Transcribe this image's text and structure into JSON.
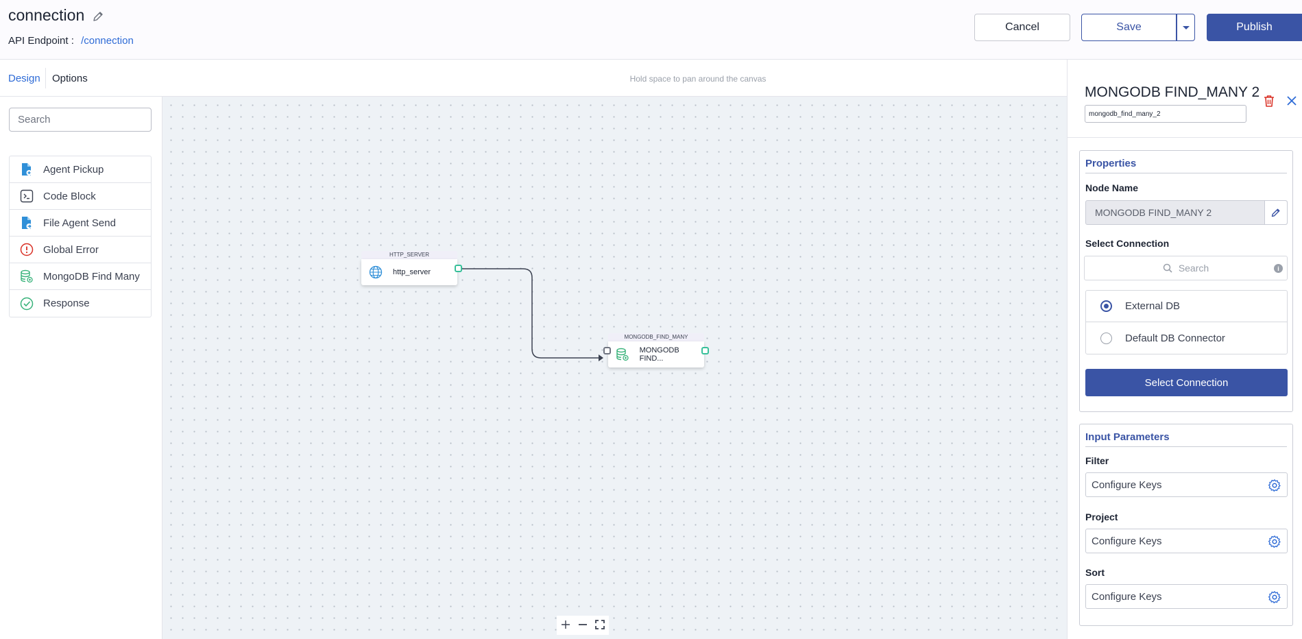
{
  "header": {
    "title": "connection",
    "endpoint_label": "API Endpoint :",
    "endpoint_path": "/connection",
    "cancel_label": "Cancel",
    "save_label": "Save",
    "publish_label": "Publish"
  },
  "tabs": {
    "design": "Design",
    "options": "Options",
    "hint": "Hold space to pan around the canvas"
  },
  "palette": {
    "search_placeholder": "Search",
    "items": [
      {
        "label": "Agent Pickup",
        "icon": "agent-pickup-icon"
      },
      {
        "label": "Code Block",
        "icon": "code-block-icon"
      },
      {
        "label": "File Agent Send",
        "icon": "file-agent-send-icon"
      },
      {
        "label": "Global Error",
        "icon": "global-error-icon"
      },
      {
        "label": "MongoDB Find Many",
        "icon": "mongodb-icon"
      },
      {
        "label": "Response",
        "icon": "response-icon"
      }
    ]
  },
  "canvas": {
    "nodes": [
      {
        "type": "HTTP_SERVER",
        "label": "http_server",
        "icon": "globe-icon"
      },
      {
        "type": "MONGODB_FIND_MANY",
        "label": "MONGODB FIND...",
        "icon": "mongodb-icon"
      }
    ]
  },
  "panel": {
    "title": "MONGODB FIND_MANY 2",
    "node_id": "mongodb_find_many_2",
    "properties": {
      "heading": "Properties",
      "node_name_label": "Node Name",
      "node_name_value": "MONGODB FIND_MANY 2",
      "select_connection_label": "Select Connection",
      "search_placeholder": "Search",
      "radio_external": "External DB",
      "radio_default": "Default DB Connector",
      "selected_radio": "External DB",
      "select_button": "Select Connection"
    },
    "inputs": {
      "heading": "Input Parameters",
      "filter_label": "Filter",
      "filter_value": "Configure Keys",
      "project_label": "Project",
      "project_value": "Configure Keys",
      "sort_label": "Sort",
      "sort_value": "Configure Keys"
    }
  },
  "colors": {
    "primary": "#3a54a5",
    "link": "#2e6bd6",
    "port_green": "#38c09a",
    "danger": "#d93025",
    "canvas_bg": "#eef2f6"
  }
}
